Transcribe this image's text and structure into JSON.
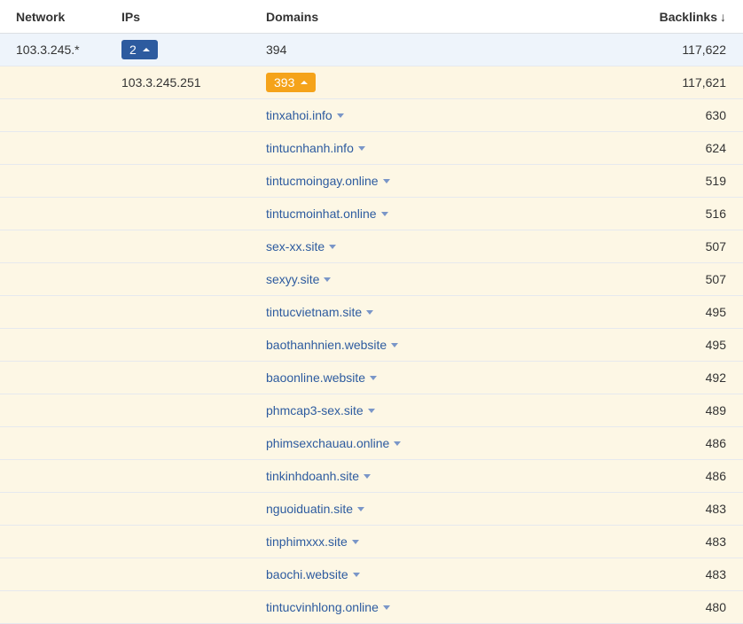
{
  "header": {
    "network": "Network",
    "ips": "IPs",
    "domains": "Domains",
    "backlinks": "Backlinks",
    "sort_icon": "↓"
  },
  "network_row": {
    "network": "103.3.245.*",
    "ips_count": "2",
    "domains": "394",
    "backlinks": "117,622"
  },
  "ip_row": {
    "ip": "103.3.245.251",
    "domains_count": "393",
    "backlinks": "117,621"
  },
  "domains": [
    {
      "name": "tinxahoi.info",
      "backlinks": "630"
    },
    {
      "name": "tintucnhanh.info",
      "backlinks": "624"
    },
    {
      "name": "tintucmoingay.online",
      "backlinks": "519"
    },
    {
      "name": "tintucmoinhat.online",
      "backlinks": "516"
    },
    {
      "name": "sex-xx.site",
      "backlinks": "507"
    },
    {
      "name": "sexyy.site",
      "backlinks": "507"
    },
    {
      "name": "tintucvietnam.site",
      "backlinks": "495"
    },
    {
      "name": "baothanhnien.website",
      "backlinks": "495"
    },
    {
      "name": "baoonline.website",
      "backlinks": "492"
    },
    {
      "name": "phmcap3-sex.site",
      "backlinks": "489"
    },
    {
      "name": "phimsexchauau.online",
      "backlinks": "486"
    },
    {
      "name": "tinkinhdoanh.site",
      "backlinks": "486"
    },
    {
      "name": "nguoiduatin.site",
      "backlinks": "483"
    },
    {
      "name": "tinphimxxx.site",
      "backlinks": "483"
    },
    {
      "name": "baochi.website",
      "backlinks": "483"
    },
    {
      "name": "tintucvinhlong.online",
      "backlinks": "480"
    }
  ],
  "colors": {
    "badge_blue": "#2d5b9f",
    "badge_orange": "#f5a31a",
    "link": "#2d5b9f",
    "network_row_bg": "#eef4fb",
    "domain_row_bg": "#fdf7e5"
  }
}
